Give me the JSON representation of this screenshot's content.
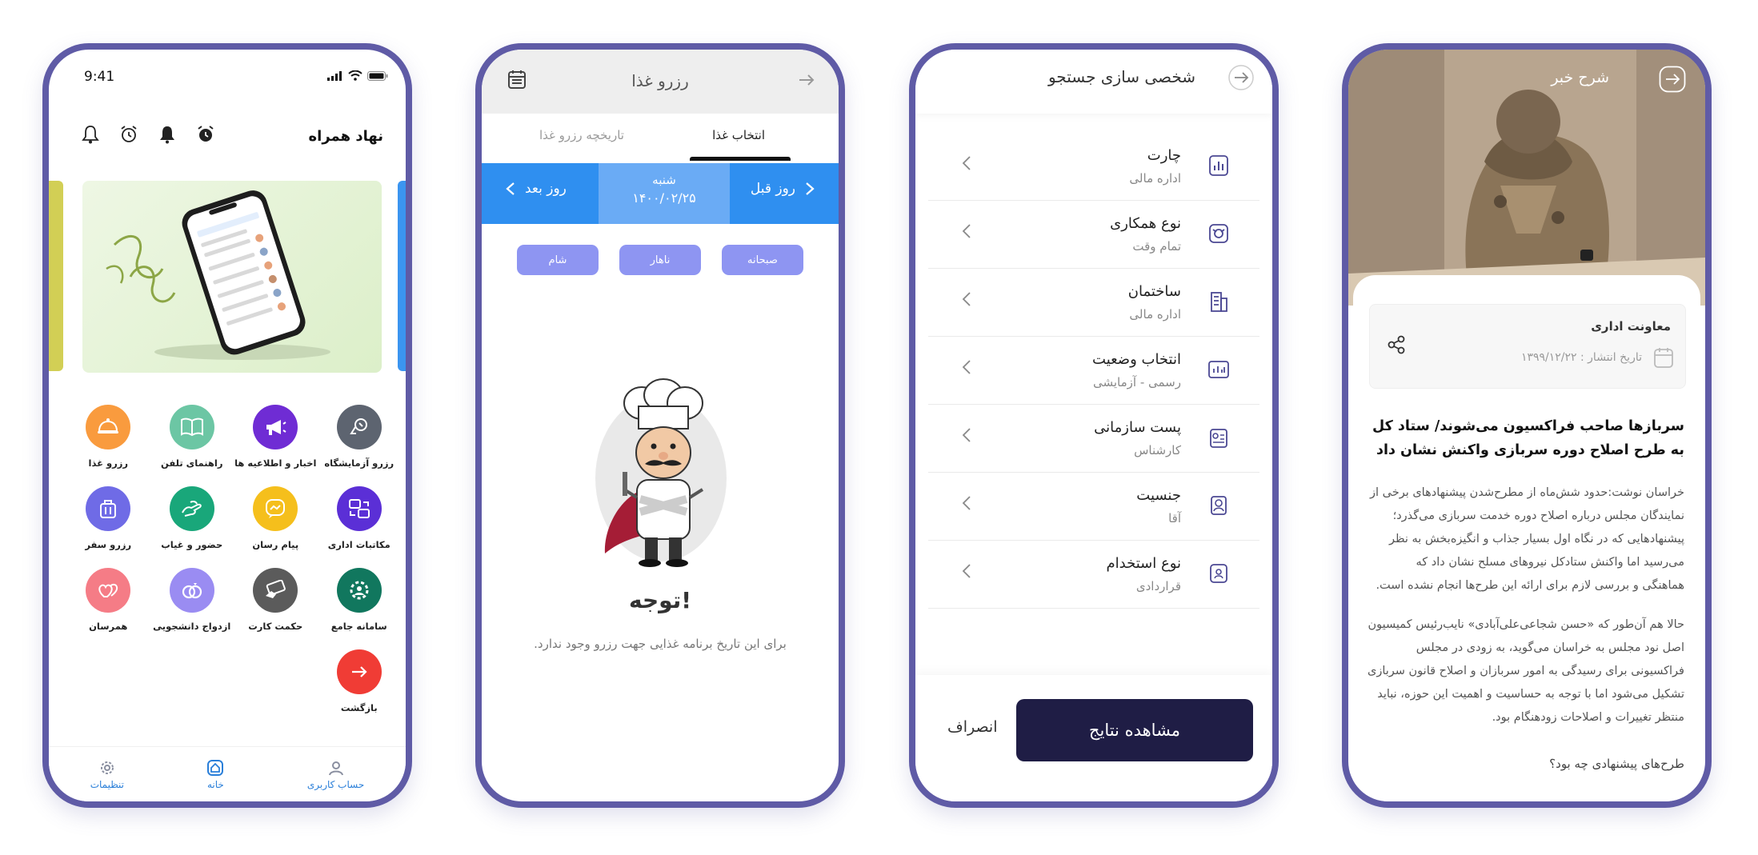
{
  "phone1": {
    "status_time": "9:41",
    "title": "نهاد همراه",
    "apps": [
      {
        "label": "رزرو آزمایشگاه",
        "color": "#5d6470",
        "icon": "lab-icon"
      },
      {
        "label": "اخبار و اطلاعیه ها",
        "color": "#6f2cd4",
        "icon": "megaphone-icon"
      },
      {
        "label": "راهنمای تلفن",
        "color": "#6cc6a4",
        "icon": "book-icon"
      },
      {
        "label": "رزرو غذا",
        "color": "#f99b3e",
        "icon": "food-tray-icon"
      },
      {
        "label": "مکاتبات اداری",
        "color": "#5b2fd6",
        "icon": "mail-exchange-icon"
      },
      {
        "label": "پیام رسان",
        "color": "#f5bf1c",
        "icon": "chat-bubble-icon"
      },
      {
        "label": "حضور و غیاب",
        "color": "#19a77a",
        "icon": "fingerprint-icon"
      },
      {
        "label": "رزرو سفر",
        "color": "#6f6be6",
        "icon": "suitcase-icon"
      },
      {
        "label": "سامانه جامع",
        "color": "#11775e",
        "icon": "gear-person-icon"
      },
      {
        "label": "حکمت کارت",
        "color": "#5b5b5b",
        "icon": "card-icon"
      },
      {
        "label": "ازدواج دانشجویی",
        "color": "#9a8cf2",
        "icon": "rings-icon"
      },
      {
        "label": "همرسان",
        "color": "#f57c86",
        "icon": "hearts-icon"
      },
      {
        "label": "بازگشت",
        "color": "#f03c35",
        "icon": "arrow-right-icon"
      }
    ],
    "nav": {
      "settings": "تنظیمات",
      "home": "خانه",
      "account": "حساب کاربری"
    }
  },
  "phone2": {
    "title": "رزرو غذا",
    "tab_active": "انتخاب غذا",
    "tab_inactive": "تاریخچه رزرو غذا",
    "prev_day": "روز قبل",
    "next_day": "روز بعد",
    "day_name": "شنبه",
    "date": "۱۴۰۰/۰۲/۲۵",
    "meals": [
      "صبحانه",
      "ناهار",
      "شام"
    ],
    "notice_title": "توجه!",
    "notice_text": "برای این تاریخ برنامه غذایی جهت رزرو وجود ندارد."
  },
  "phone3": {
    "title": "شخصی سازی جستجو",
    "rows": [
      {
        "title": "چارت",
        "sub": "اداره مالی",
        "icon": "chart-icon"
      },
      {
        "title": "نوع همکاری",
        "sub": "تمام وقت",
        "icon": "handshake-icon"
      },
      {
        "title": "ساختمان",
        "sub": "اداره مالی",
        "icon": "building-icon"
      },
      {
        "title": "انتخاب وضعیت",
        "sub": "رسمی - آزمایشی",
        "icon": "status-icon"
      },
      {
        "title": "پست سازمانی",
        "sub": "کارشناس",
        "icon": "id-card-icon"
      },
      {
        "title": "جنسیت",
        "sub": "آقا",
        "icon": "person-badge-icon"
      },
      {
        "title": "نوع استخدام",
        "sub": "قراردادی",
        "icon": "contract-icon"
      }
    ],
    "primary_button": "مشاهده نتایج",
    "cancel_button": "انصراف"
  },
  "phone4": {
    "title": "شرح خبر",
    "organization": "معاونت اداری",
    "publish_date": "تاریخ انتشار : ۱۳۹۹/۱۲/۲۲",
    "headline": "سربازها صاحب فراکسیون می‌شوند/ ستاد کل به طرح اصلاح دوره سربازی واکنش نشان داد",
    "body_lines_1": [
      "خراسان نوشت:حدود شش‌ماه از مطرح‌شدن پیشنهادهای برخی از",
      "نمایندگان مجلس درباره اصلاح دوره خدمت سربازی می‌گذرد؛",
      "پیشنهادهایی که در نگاه اول بسیار جذاب و انگیزه‌بخش به نظر",
      "می‌رسید اما واکنش ستادکل نیروهای مسلح نشان داد که",
      ".هماهنگی و بررسی لازم برای ارائه این طرح‌ها انجام نشده است"
    ],
    "body_lines_2": [
      "حالا هم آن‌طور که «حسن شجاعی‌علی‌آبادی» نایب‌رئیس کمیسیون",
      "اصل نود مجلس به خراسان می‌گوید، به زودی در مجلس",
      "فراکسیونی برای رسیدگی به امور سربازان و اصلاح قانون سربازی",
      "تشکیل می‌شود اما با توجه به حساسیت و اهمیت این حوزه، نباید",
      ".منتظر تغییرات و اصلاحات زودهنگام بود"
    ],
    "question": "طرح‌های پیشنهادی چه بود؟"
  }
}
